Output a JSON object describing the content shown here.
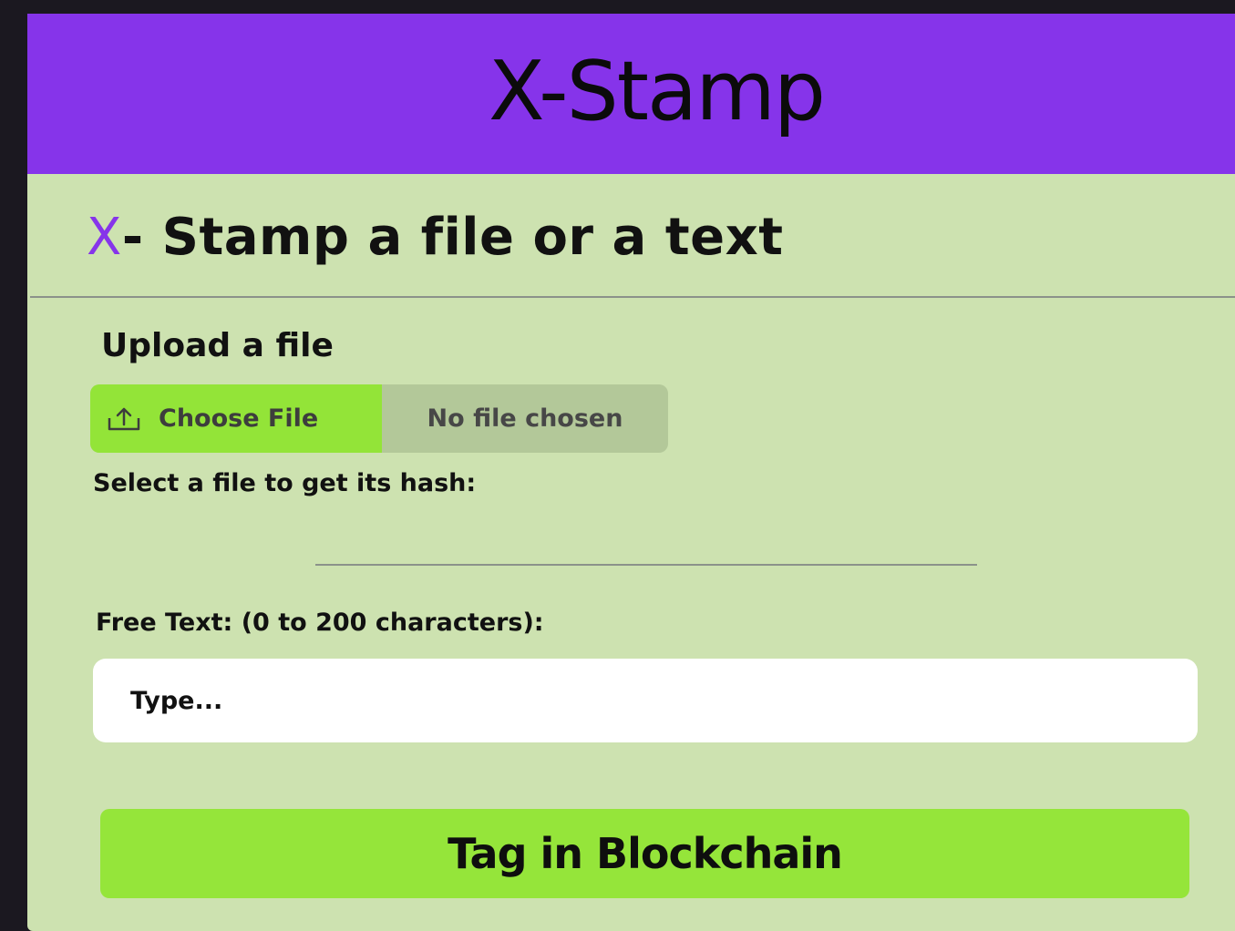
{
  "header": {
    "title": "X-Stamp"
  },
  "section": {
    "heading_prefix": "X",
    "heading_rest": "- Stamp a file or a text"
  },
  "upload": {
    "label": "Upload a file",
    "button_label": "Choose File",
    "button_icon": "upload-icon",
    "status": "No file chosen"
  },
  "hash": {
    "label": "Select a file to get its hash:",
    "value": ""
  },
  "free_text": {
    "label": "Free Text: (0 to 200 characters):",
    "placeholder": "Type...",
    "value": ""
  },
  "action": {
    "button_label": "Tag in Blockchain"
  },
  "colors": {
    "accent": "#8634ea",
    "green": "#95e53a",
    "background": "#cde2b0"
  }
}
